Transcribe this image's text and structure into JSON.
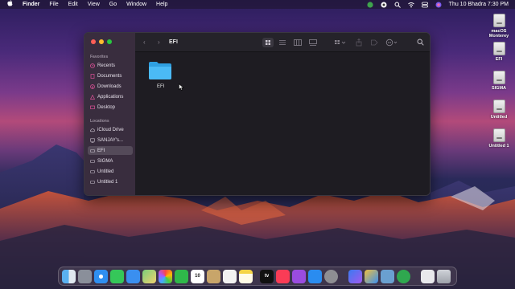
{
  "menubar": {
    "apple_icon": "apple-icon",
    "app_name": "Finder",
    "items": [
      "File",
      "Edit",
      "View",
      "Go",
      "Window",
      "Help"
    ],
    "clock": "Thu 10 Bhadra  7:30 PM"
  },
  "desktop_icons": [
    {
      "label": "macOS Monterey",
      "icon": "disk-icon"
    },
    {
      "label": "EFI",
      "icon": "disk-icon"
    },
    {
      "label": "SIGMA",
      "icon": "disk-icon"
    },
    {
      "label": "Untitled",
      "icon": "disk-icon"
    },
    {
      "label": "Untitled 1",
      "icon": "disk-icon"
    }
  ],
  "window": {
    "title": "EFI",
    "favorites_header": "Favorites",
    "locations_header": "Locations",
    "favorites": [
      "Recents",
      "Documents",
      "Downloads",
      "Applications",
      "Desktop"
    ],
    "locations": [
      "iCloud Drive",
      "SANJAY's...",
      "EFI",
      "SIGMA",
      "Untitled",
      "Untitled 1"
    ],
    "selected_location": "EFI",
    "items": [
      {
        "name": "EFI",
        "kind": "folder"
      }
    ],
    "traffic_colors": [
      "#ff5f57",
      "#febc2e",
      "#28c840"
    ],
    "accent_folder": "#3ab0f0"
  },
  "dock": {
    "apps": [
      "Finder",
      "Launchpad",
      "Safari",
      "Messages",
      "Mail",
      "Maps",
      "Photos",
      "FaceTime",
      "Calendar",
      "Contacts",
      "Reminders",
      "Notes",
      "TV",
      "Music",
      "Podcasts",
      "App Store",
      "System Preferences",
      "Stack",
      "Xcode",
      "Preview",
      "Downloads",
      "Trash"
    ],
    "calendar_day": "10",
    "tv_label": "tv"
  }
}
